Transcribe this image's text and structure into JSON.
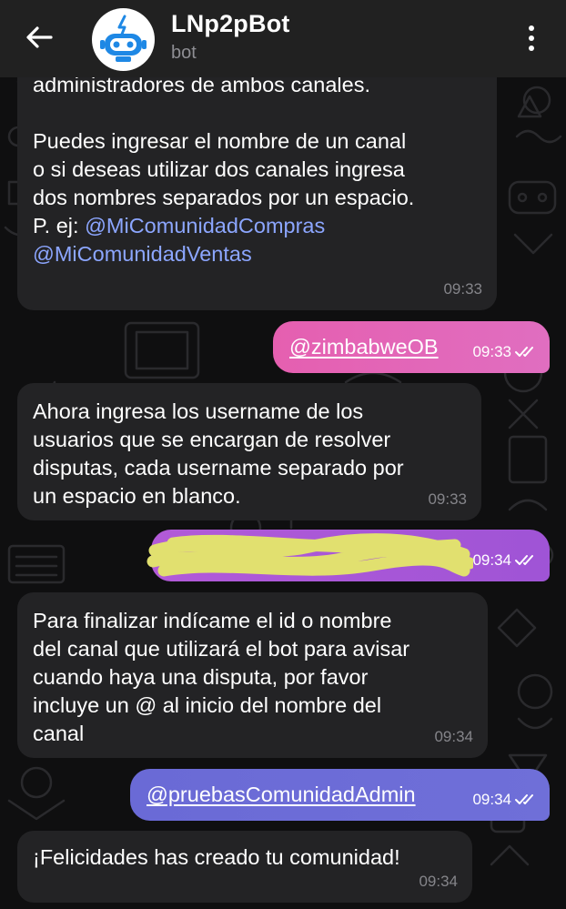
{
  "header": {
    "title": "LNp2pBot",
    "subtitle": "bot"
  },
  "messages": [
    {
      "direction": "in",
      "text_top": "administradores de ambos canales.\n\nPuedes ingresar el nombre de un canal\no si deseas utilizar dos canales ingresa\ndos nombres separados por un espacio.\n\n",
      "example_prefix": "P. ej: ",
      "link_1": "@MiComunidadCompras",
      "link_2": "@MiComunidadVentas",
      "time": "09:33"
    },
    {
      "direction": "out",
      "text": "@zimbabweOB",
      "time": "09:33",
      "status": "read"
    },
    {
      "direction": "in",
      "text": "Ahora ingresa los username de los\nusuarios que se encargan de resolver\ndisputas, cada username separado por\nun espacio en blanco.",
      "time": "09:33"
    },
    {
      "direction": "out",
      "text": "",
      "redacted": true,
      "time": "09:34",
      "status": "read"
    },
    {
      "direction": "in",
      "text": "Para finalizar indícame el id o nombre\ndel canal que utilizará el bot para avisar\ncuando haya una disputa, por favor\nincluye un @ al inicio del nombre del\ncanal",
      "time": "09:34"
    },
    {
      "direction": "out",
      "text": "@pruebasComunidadAdmin",
      "time": "09:34",
      "status": "read"
    },
    {
      "direction": "in",
      "text": "¡Felicidades has creado tu comunidad!",
      "time": "09:34"
    }
  ],
  "colors": {
    "header_bg": "#212121",
    "incoming_bubble": "#232325",
    "outgoing_gradient_pink": "#e55fb0",
    "outgoing_gradient_purple": "#a150d4",
    "outgoing_gradient_blue": "#6b6bd6",
    "link": "#8ca6ff",
    "redaction_scribble": "#e1e06f"
  },
  "icons": {
    "back": "arrow-left-icon",
    "avatar": "robot-icon",
    "menu": "more-vertical-icon",
    "ticks": "double-check-icon"
  }
}
